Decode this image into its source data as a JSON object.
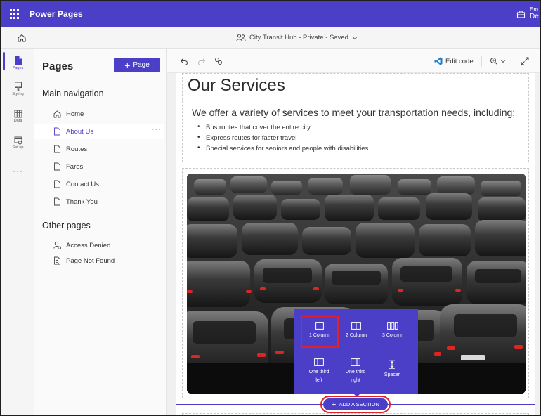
{
  "header": {
    "app_title": "Power Pages",
    "user_line1": "Em",
    "user_line2": "De"
  },
  "site_bar": {
    "site_label": "City Transit Hub - Private - Saved"
  },
  "rail": {
    "items": [
      {
        "label": "Pages",
        "icon": "page-icon",
        "active": true
      },
      {
        "label": "Styling",
        "icon": "brush-icon",
        "active": false
      },
      {
        "label": "Data",
        "icon": "table-icon",
        "active": false
      },
      {
        "label": "Set up",
        "icon": "setup-icon",
        "active": false
      }
    ],
    "more": "···"
  },
  "pages_panel": {
    "title": "Pages",
    "add_button": "Page",
    "main_nav_heading": "Main navigation",
    "main_nav": [
      {
        "label": "Home",
        "icon": "home-icon"
      },
      {
        "label": "About Us",
        "icon": "page-icon",
        "selected": true
      },
      {
        "label": "Routes",
        "icon": "page-icon"
      },
      {
        "label": "Fares",
        "icon": "page-icon"
      },
      {
        "label": "Contact Us",
        "icon": "page-icon"
      },
      {
        "label": "Thank You",
        "icon": "page-icon"
      }
    ],
    "item_more": "···",
    "other_heading": "Other pages",
    "other_pages": [
      {
        "label": "Access Denied",
        "icon": "person-lock-icon"
      },
      {
        "label": "Page Not Found",
        "icon": "page-search-icon"
      }
    ]
  },
  "toolbar": {
    "edit_code": "Edit code"
  },
  "page_content": {
    "heading": "Our Services",
    "intro": "We offer a variety of services to meet your transportation needs, including:",
    "services": [
      "Bus routes that cover the entire city",
      "Express routes for faster travel",
      "Special services for seniors and people with disabilities"
    ]
  },
  "layout_popup": {
    "options": [
      {
        "line1": "1 Column",
        "line2": "",
        "icon": "one-column-icon",
        "selected": true
      },
      {
        "line1": "2 Column",
        "line2": "",
        "icon": "two-column-icon",
        "selected": false
      },
      {
        "line1": "3 Column",
        "line2": "",
        "icon": "three-column-icon",
        "selected": false
      },
      {
        "line1": "One third",
        "line2": "left",
        "icon": "one-third-left-icon",
        "selected": false
      },
      {
        "line1": "One third",
        "line2": "right",
        "icon": "one-third-right-icon",
        "selected": false
      },
      {
        "line1": "Spacer",
        "line2": "",
        "icon": "spacer-icon",
        "selected": false
      }
    ]
  },
  "add_section": {
    "label": "ADD A SECTION"
  },
  "colors": {
    "brand": "#4c3fc7",
    "highlight": "#e0202a"
  }
}
